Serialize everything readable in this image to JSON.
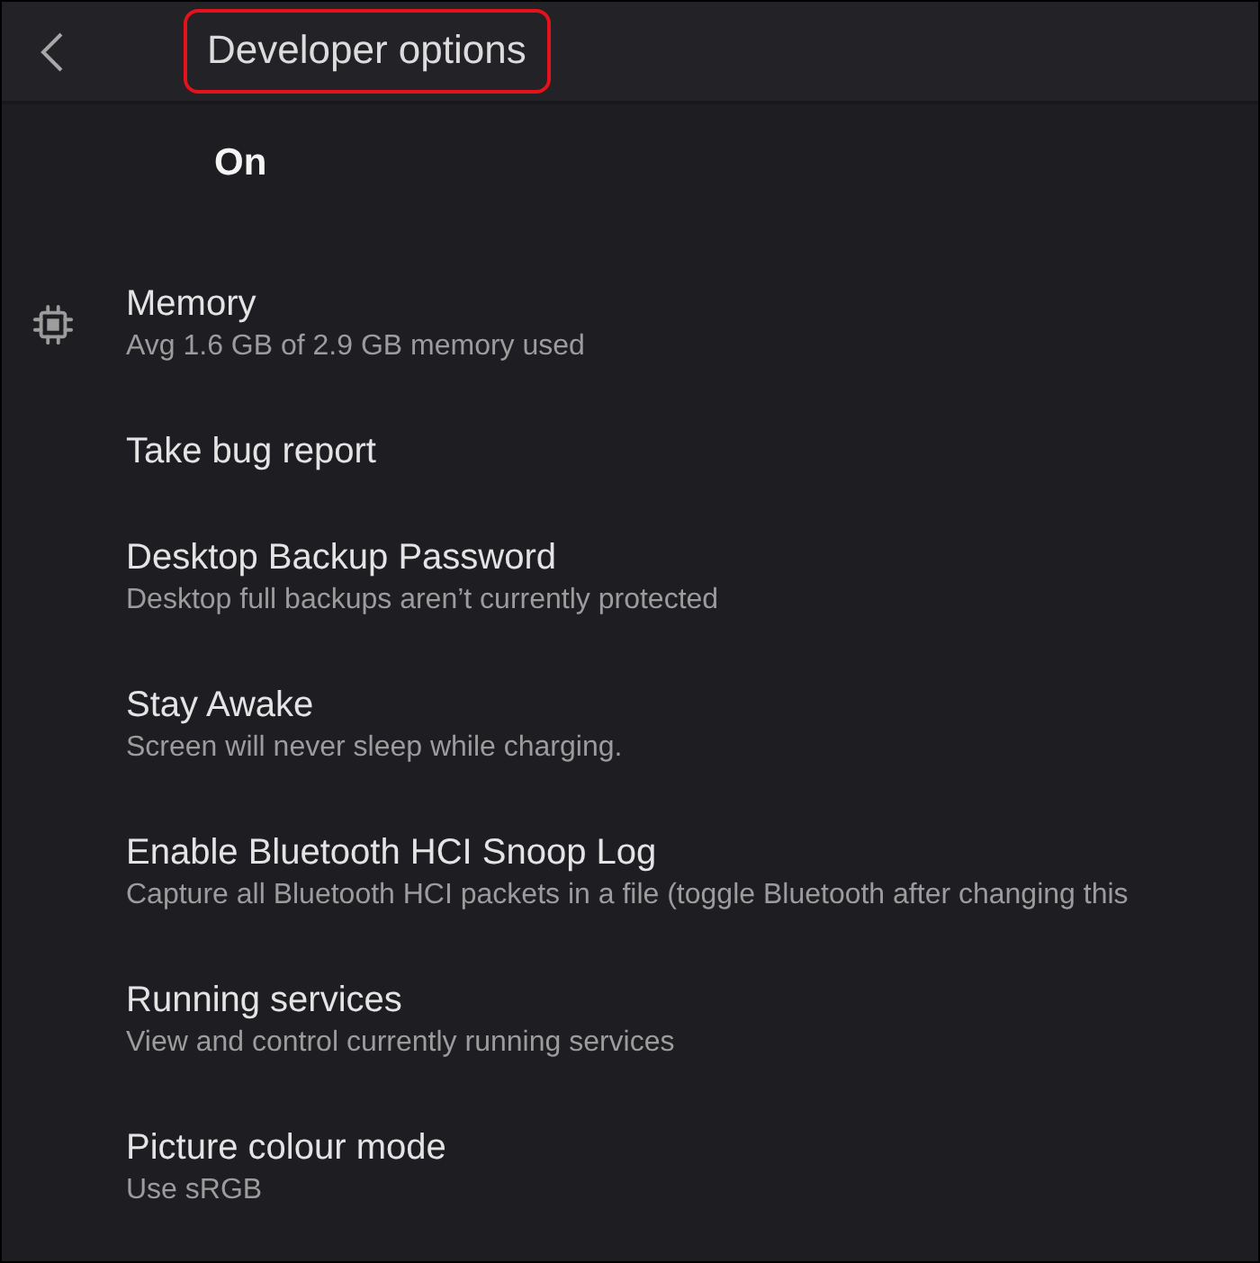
{
  "header": {
    "title": "Developer options",
    "title_highlighted": true
  },
  "master_switch": {
    "label": "On"
  },
  "items": [
    {
      "kind": "icon",
      "title": "Memory",
      "subtitle": "Avg 1.6 GB of 2.9 GB memory used"
    },
    {
      "kind": "plain",
      "title": "Take bug report"
    },
    {
      "kind": "plain",
      "title": "Desktop Backup Password",
      "subtitle": "Desktop full backups aren’t currently protected"
    },
    {
      "kind": "plain",
      "title": "Stay Awake",
      "subtitle": "Screen will never sleep while charging."
    },
    {
      "kind": "plain",
      "title": "Enable Bluetooth HCI Snoop Log",
      "subtitle": "Capture all Bluetooth HCI packets in a file (toggle Bluetooth after changing this"
    },
    {
      "kind": "plain",
      "title": "Running services",
      "subtitle": "View and control currently running services"
    },
    {
      "kind": "plain",
      "title": "Picture colour mode",
      "subtitle": "Use sRGB"
    }
  ]
}
